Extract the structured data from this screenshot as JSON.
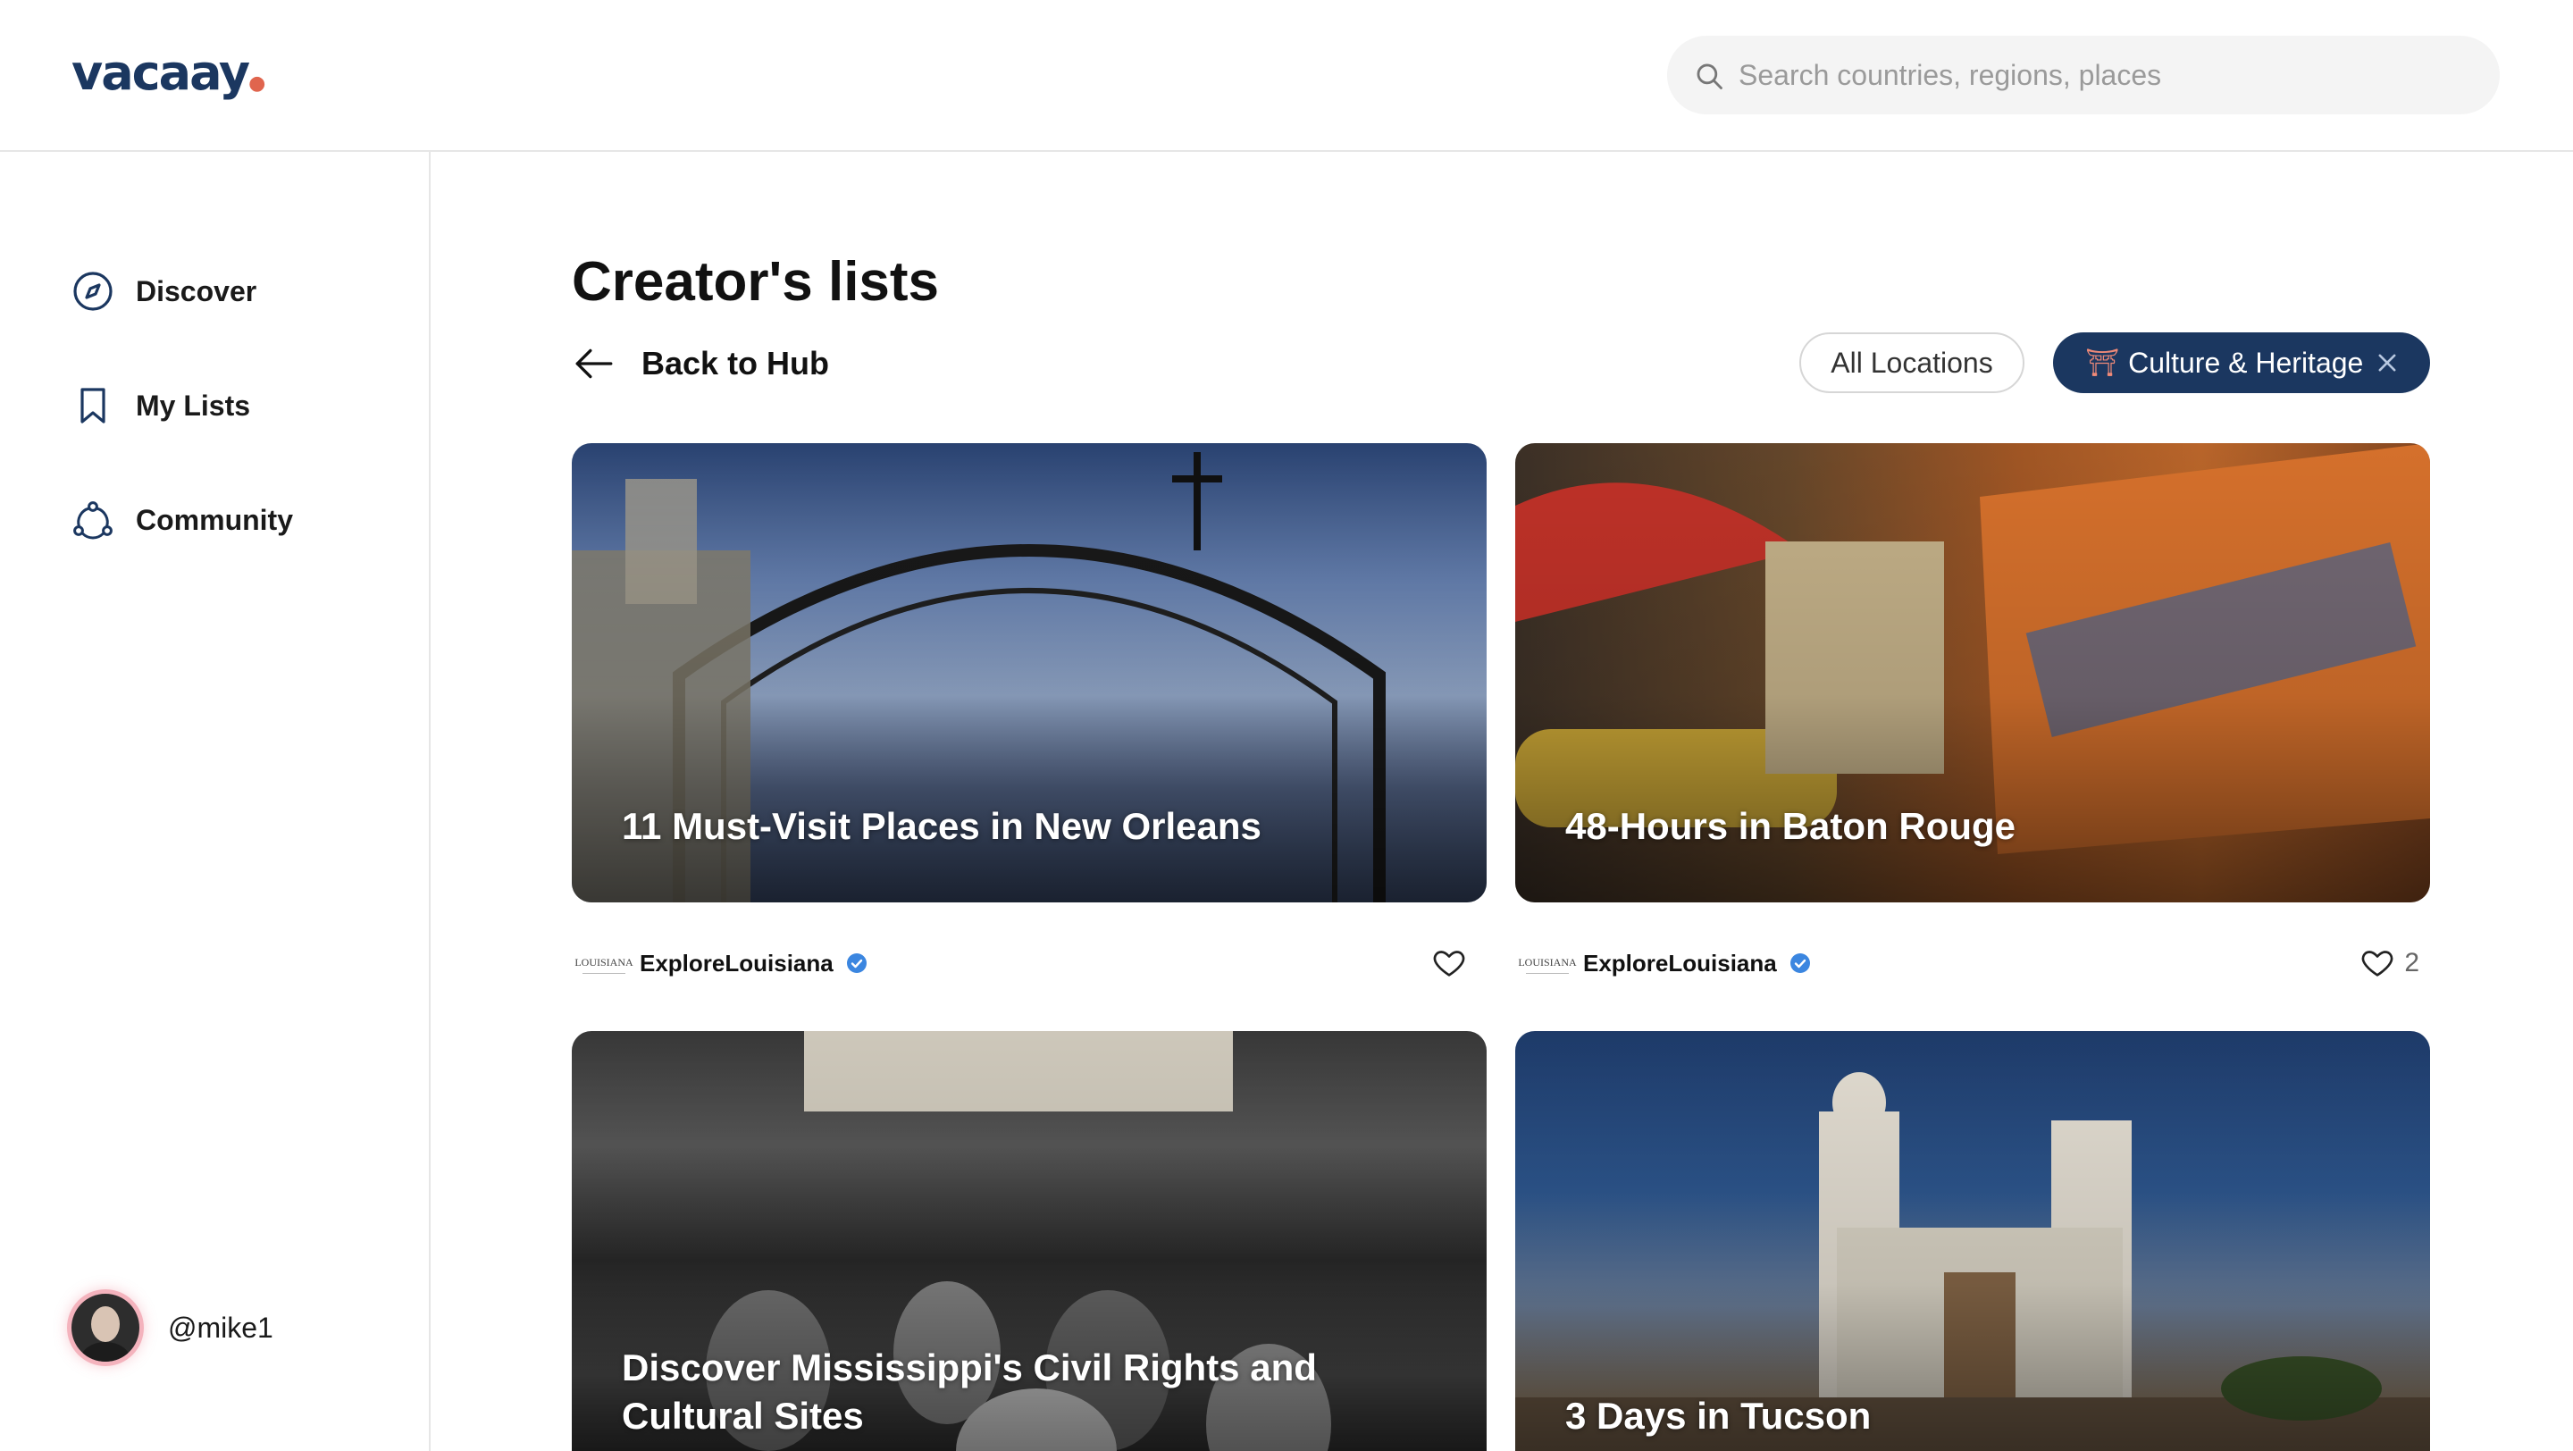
{
  "header": {
    "logo": "vacaay",
    "search_placeholder": "Search countries, regions, places"
  },
  "sidebar": {
    "items": [
      {
        "label": "Discover",
        "icon": "compass-icon"
      },
      {
        "label": "My Lists",
        "icon": "bookmark-icon"
      },
      {
        "label": "Community",
        "icon": "community-icon"
      }
    ],
    "user": {
      "handle": "@mike1"
    }
  },
  "main": {
    "title": "Creator's lists",
    "back_label": "Back to Hub",
    "filters": {
      "all_locations": "All Locations",
      "active": "Culture & Heritage",
      "active_icon": "torii-gate-icon"
    },
    "cards": [
      {
        "title": "11 Must-Visit Places in New Orleans",
        "publisher": "ExploreLouisiana",
        "publisher_logo": "LOUISIANA",
        "likes": ""
      },
      {
        "title": "48-Hours in Baton Rouge",
        "publisher": "ExploreLouisiana",
        "publisher_logo": "LOUISIANA",
        "likes": "2"
      },
      {
        "title": "Discover Mississippi's Civil Rights and Cultural Sites"
      },
      {
        "title": "3 Days in Tucson"
      }
    ]
  },
  "colors": {
    "brand_navy": "#1b3760",
    "accent_coral": "#e0654e",
    "verified_blue": "#3b86e0"
  }
}
